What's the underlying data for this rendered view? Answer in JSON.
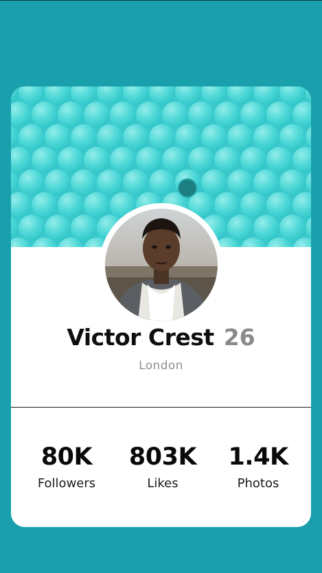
{
  "profile": {
    "name": "Victor Crest",
    "age": "26",
    "location": "London"
  },
  "stats": [
    {
      "value": "80K",
      "label": "Followers"
    },
    {
      "value": "803K",
      "label": "Likes"
    },
    {
      "value": "1.4K",
      "label": "Photos"
    }
  ],
  "colors": {
    "page_background": "#1aa0ad",
    "header_pattern": "#3ecfd2",
    "card_background": "#ffffff",
    "age_text": "#8a8a8a",
    "location_text": "#8f8f8f"
  }
}
